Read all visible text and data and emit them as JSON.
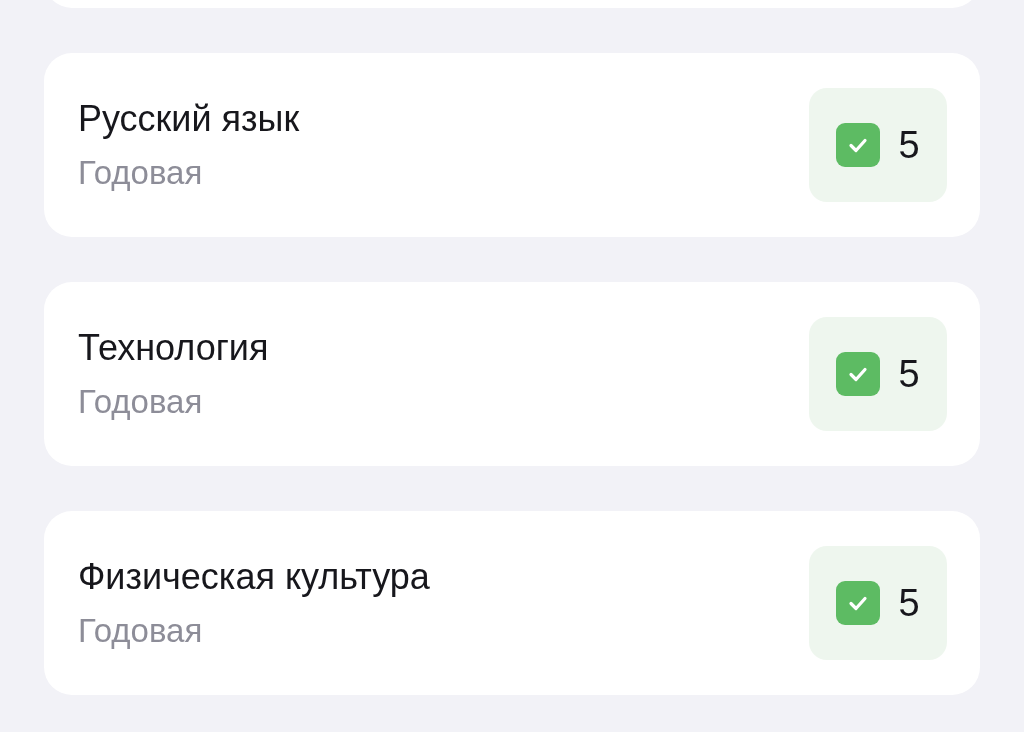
{
  "grades": [
    {
      "subject": "Русский язык",
      "period": "Годовая",
      "mark": "5",
      "checked": true
    },
    {
      "subject": "Технология",
      "period": "Годовая",
      "mark": "5",
      "checked": true
    },
    {
      "subject": "Физическая культура",
      "period": "Годовая",
      "mark": "5",
      "checked": true
    }
  ]
}
